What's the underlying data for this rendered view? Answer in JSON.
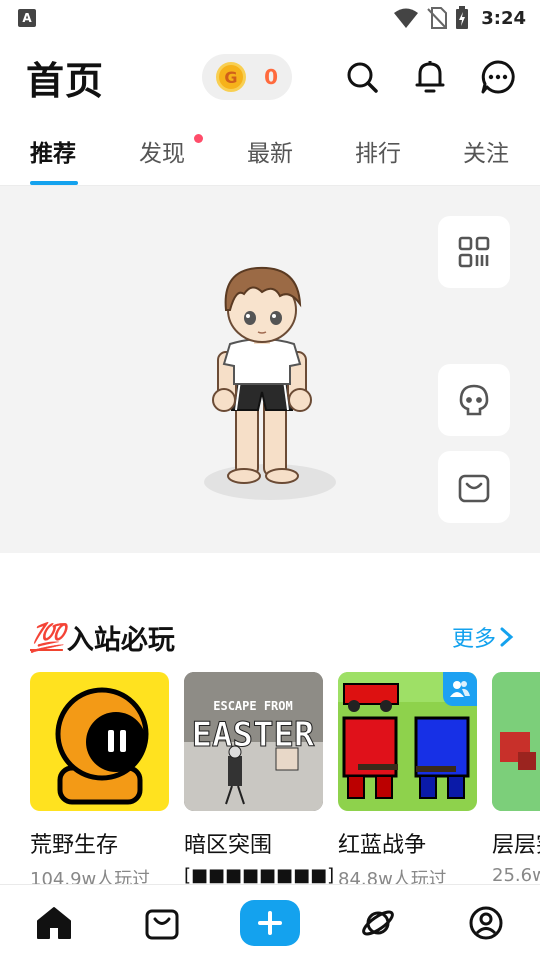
{
  "status_bar": {
    "app_badge": "A",
    "time": "3:24"
  },
  "header": {
    "title": "首页",
    "coin_symbol": "G",
    "coin_count": "0"
  },
  "tabs": [
    {
      "label": "推荐",
      "active": true
    },
    {
      "label": "发现",
      "has_dot": true
    },
    {
      "label": "最新"
    },
    {
      "label": "排行"
    },
    {
      "label": "关注"
    }
  ],
  "section": {
    "emoji": "💯",
    "title": "入站必玩",
    "more_label": "更多"
  },
  "games": [
    {
      "name": "荒野生存",
      "meta": "104.9w人玩过"
    },
    {
      "name": "暗区突围",
      "meta": "[■■■■■■■■]",
      "thumb_text_top": "ESCAPE FROM",
      "thumb_text_big": "EASTER"
    },
    {
      "name": "红蓝战争",
      "meta": "84.8w人玩过"
    },
    {
      "name": "层层突",
      "meta": "25.6w"
    }
  ],
  "colors": {
    "accent": "#14a2ee",
    "coin_count": "#ff6a3d",
    "tab_dot": "#ff4d6a"
  }
}
